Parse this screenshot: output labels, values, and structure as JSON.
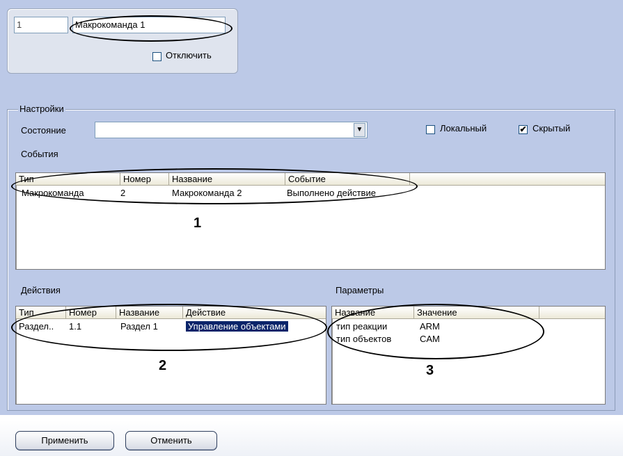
{
  "header": {
    "id_value": "1",
    "name_value": "Макрокоманда 1",
    "disable_label": "Отключить",
    "disable_checked": false
  },
  "settings": {
    "group_title": "Настройки",
    "state_label": "Состояние",
    "state_value": "",
    "local_label": "Локальный",
    "local_checked": false,
    "hidden_label": "Скрытый",
    "hidden_checked": true,
    "events_label": "События"
  },
  "events_table": {
    "columns": [
      "Тип",
      "Номер",
      "Название",
      "Событие"
    ],
    "rows": [
      [
        "Макрокоманда",
        "2",
        "Макрокоманда 2",
        "Выполнено действие"
      ]
    ],
    "callout": "1"
  },
  "actions": {
    "label": "Действия",
    "columns": [
      "Тип",
      "Номер",
      "Название",
      "Действие"
    ],
    "rows": [
      [
        "Раздел..",
        "1.1",
        "Раздел 1",
        "Управление объектами"
      ]
    ],
    "callout": "2"
  },
  "params": {
    "label": "Параметры",
    "columns": [
      "Название",
      "Значение"
    ],
    "rows": [
      [
        "тип реакции",
        "ARM"
      ],
      [
        "тип объектов",
        "CAM"
      ]
    ],
    "callout": "3"
  },
  "buttons": {
    "apply": "Применить",
    "cancel": "Отменить"
  },
  "colors": {
    "panel_bg": "#bcc9e7",
    "selection": "#0a246a"
  }
}
